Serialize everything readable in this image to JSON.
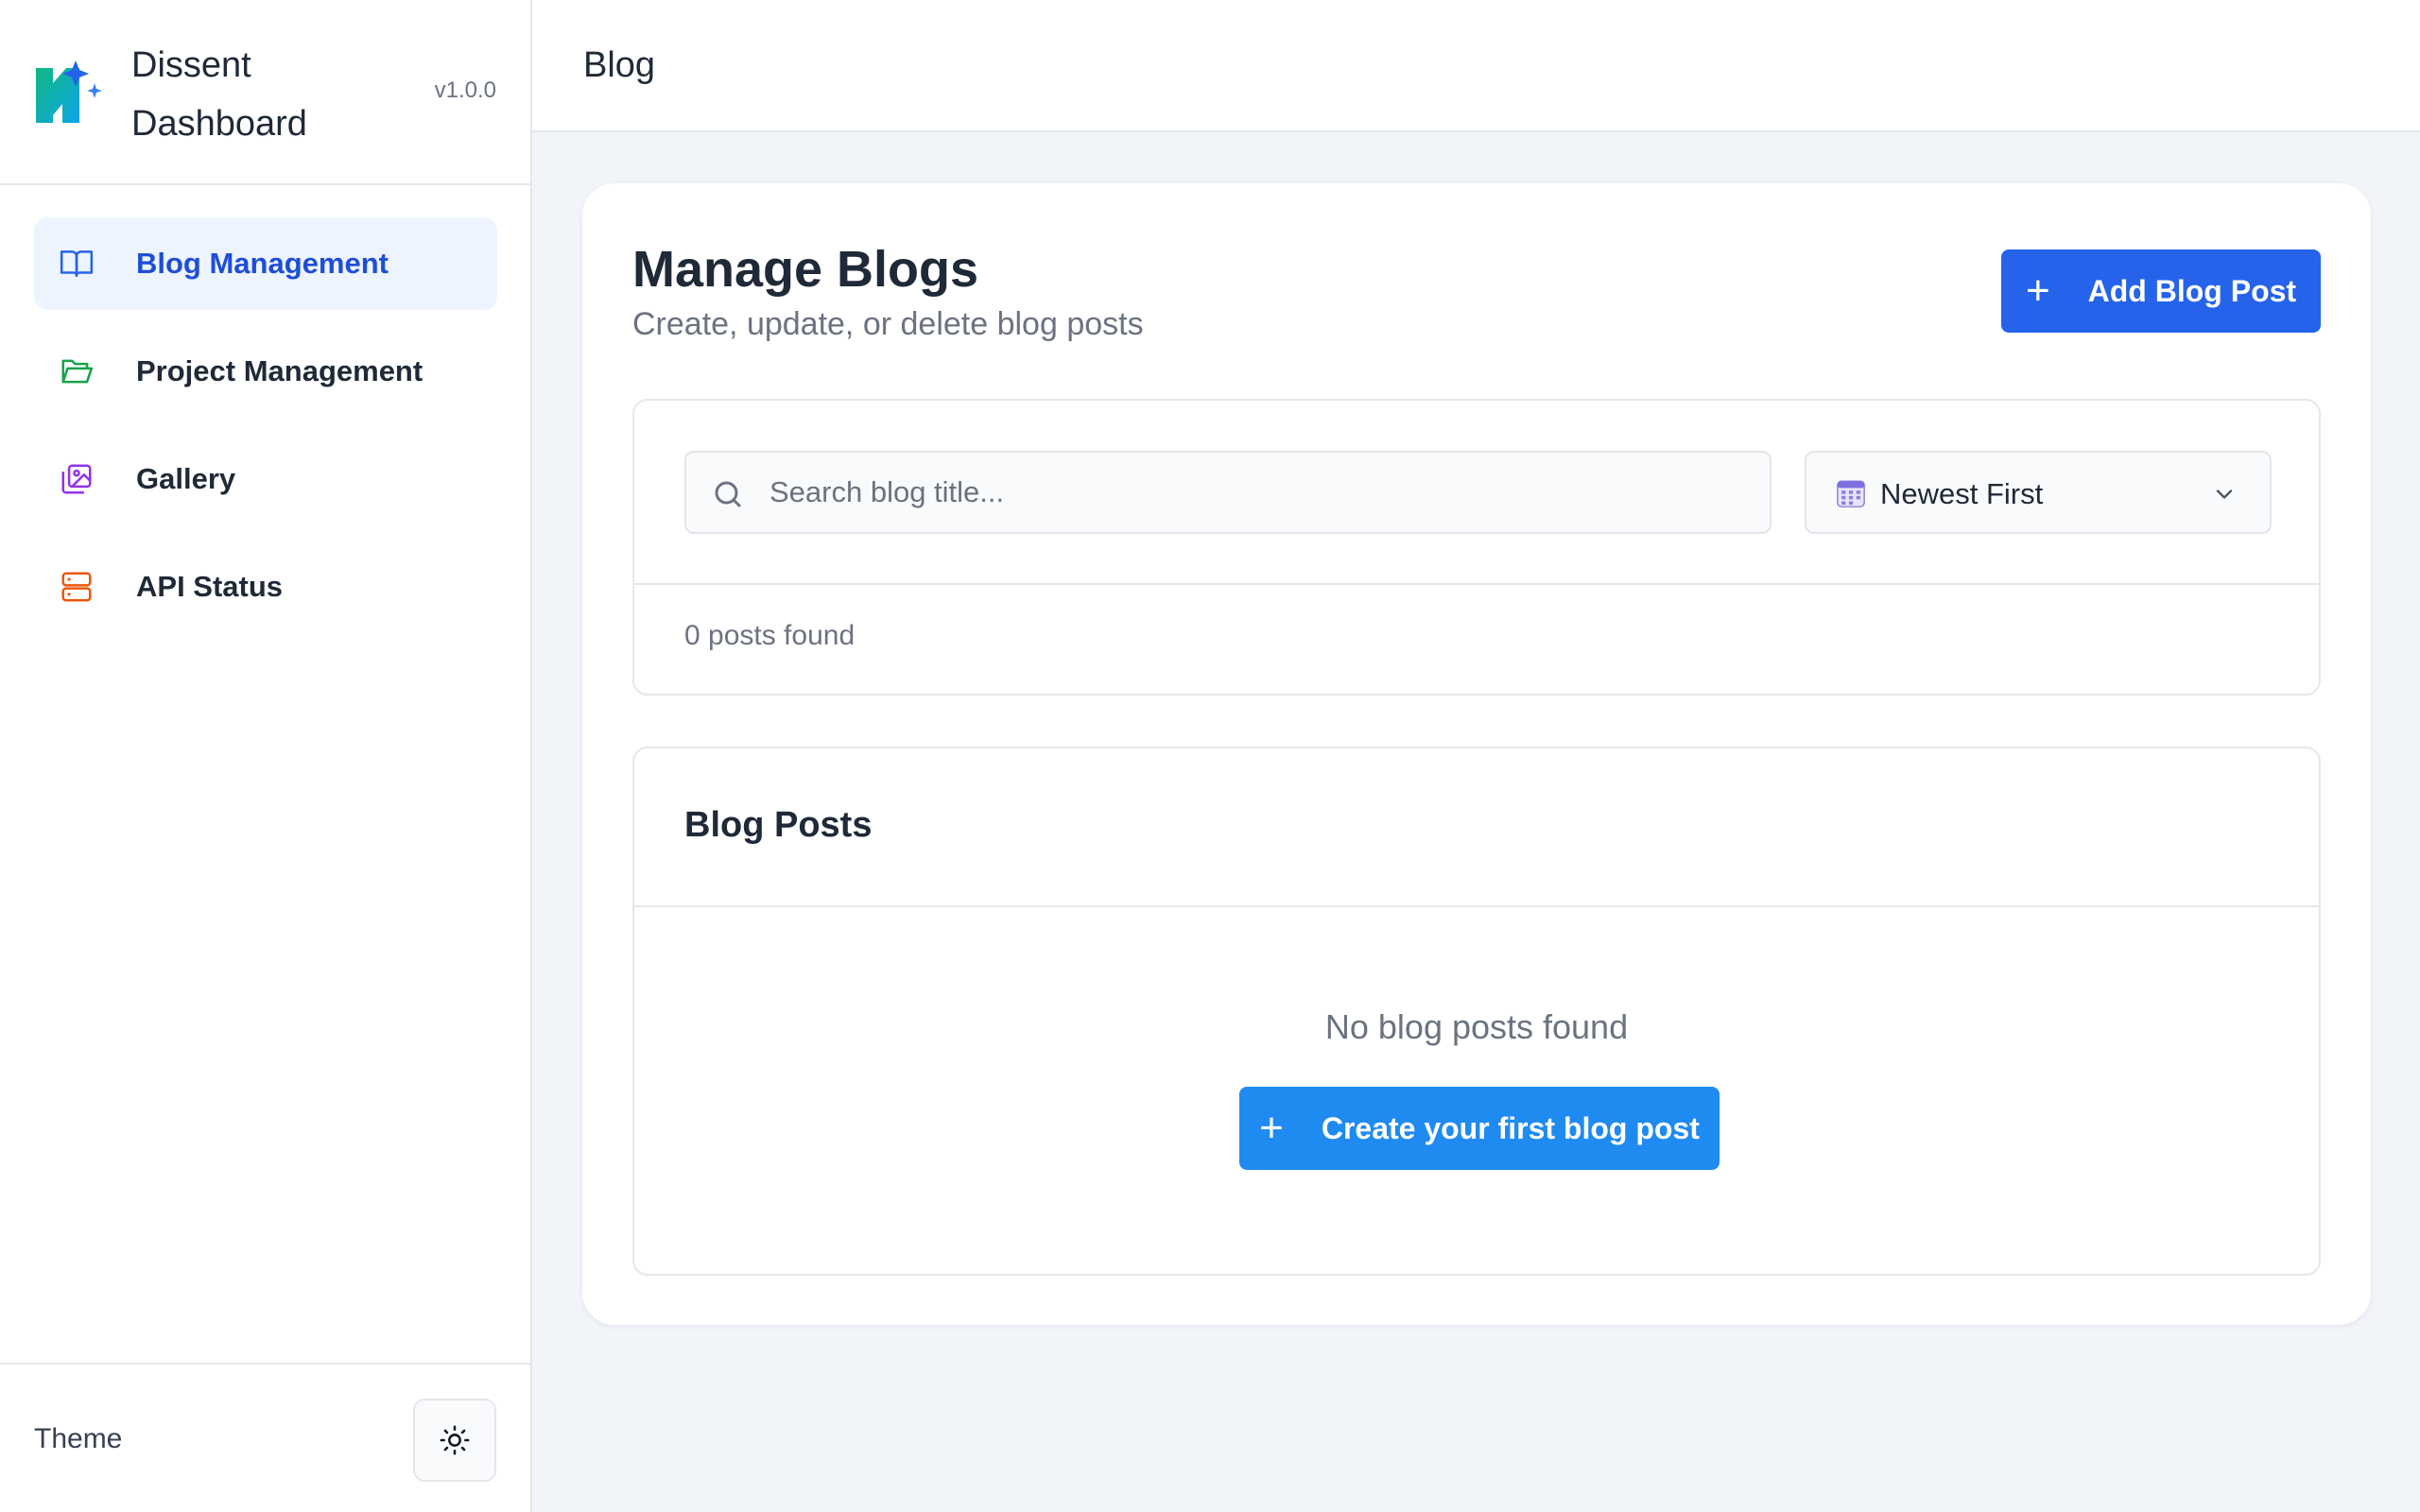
{
  "brand": {
    "name": "Dissent Dashboard",
    "version": "v1.0.0"
  },
  "sidebar": {
    "items": [
      {
        "label": "Blog Management",
        "icon": "book-open-icon",
        "color": "#2563eb",
        "active": true
      },
      {
        "label": "Project Management",
        "icon": "folder-open-icon",
        "color": "#16a34a",
        "active": false
      },
      {
        "label": "Gallery",
        "icon": "images-icon",
        "color": "#9333ea",
        "active": false
      },
      {
        "label": "API Status",
        "icon": "server-icon",
        "color": "#ea580c",
        "active": false
      }
    ],
    "footer": {
      "theme_label": "Theme",
      "theme_icon": "sun-icon"
    }
  },
  "topbar": {
    "title": "Blog"
  },
  "main": {
    "heading": "Manage Blogs",
    "subheading": "Create, update, or delete blog posts",
    "add_button": "Add Blog Post",
    "search": {
      "placeholder": "Search blog title...",
      "value": ""
    },
    "sort": {
      "selected": "Newest First"
    },
    "count_text": "0 posts found",
    "posts_panel": {
      "title": "Blog Posts",
      "empty_text": "No blog posts found",
      "create_button": "Create your first blog post"
    }
  },
  "colors": {
    "primary": "#2563eb",
    "create_button": "#1f8bf0",
    "active_nav_bg": "#eef4fe",
    "page_bg": "#f1f4f8"
  }
}
